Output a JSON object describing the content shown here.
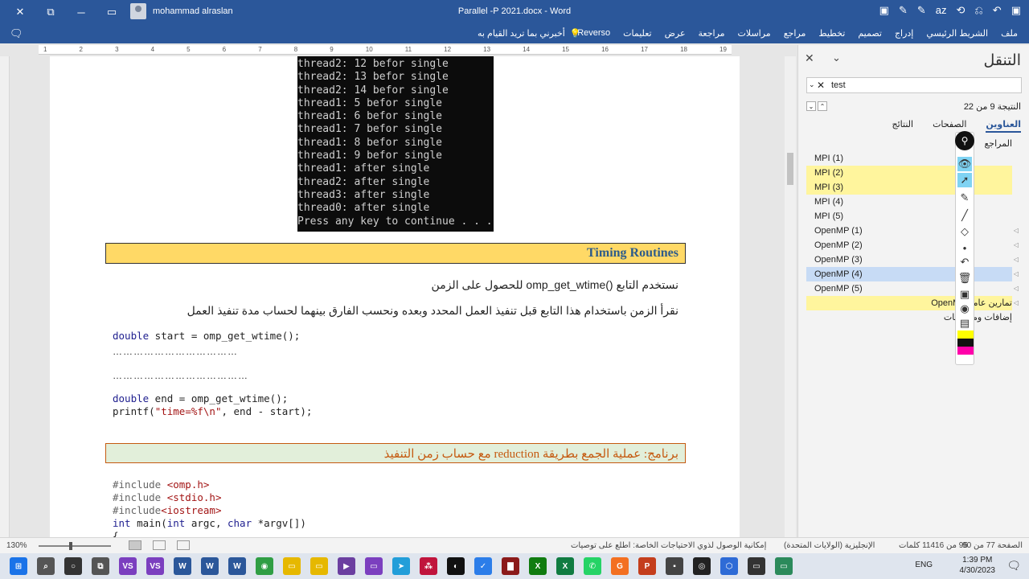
{
  "titlebar": {
    "username": "mohammad alraslan",
    "document_title": "Parallel -P 2021.docx  -  Word",
    "left_icons": [
      "✕",
      "⧉",
      "─",
      "▭"
    ],
    "right_icons": [
      "▣",
      "✎",
      "✎",
      "az",
      "⟲",
      "⎌",
      "↶",
      "▣"
    ]
  },
  "ribbon": {
    "tabs": [
      "ملف",
      "الشريط الرئيسي",
      "إدراج",
      "تصميم",
      "تخطيط",
      "مراجع",
      "مراسلات",
      "مراجعة",
      "عرض",
      "تعليمات",
      "Reverso"
    ],
    "tell_me": "أخبرني بما تريد القيام به",
    "comment_icon": "comment-icon",
    "lightbulb_icon": "lightbulb-icon"
  },
  "ruler": {
    "marks": [
      "19",
      "18",
      "17",
      "16",
      "15",
      "14",
      "13",
      "12",
      "11",
      "10",
      "9",
      "8",
      "7",
      "6",
      "5",
      "4",
      "3",
      "2",
      "1"
    ]
  },
  "document": {
    "console_lines": [
      "thread2: 12 befor single",
      "thread2: 13 befor single",
      "thread2: 14 befor single",
      "thread1: 5 befor single",
      "thread1: 6 befor single",
      "thread1: 7 befor single",
      "thread1: 8 befor single",
      "thread1: 9 befor single",
      "thread1: after single",
      "thread2: after single",
      "thread3: after single",
      "thread0: after single",
      "Press any key to continue . . ."
    ],
    "heading": "Timing Routines",
    "arabic_line1": "نستخدم التابع ()omp_get_wtime للحصول على الزمن",
    "arabic_line2": "نقرأ الزمن باستخدام هذا التابع قبل تنفيذ العمل المحدد وبعده ونحسب الفارق بينهما لحساب مدة تنفيذ العمل",
    "code1_kw": "double",
    "code1_rest": " start = omp_get_wtime();",
    "dots1": "………………………………",
    "dots2": "…………………………………",
    "code2_kw": "double",
    "code2_rest": " end = omp_get_wtime();",
    "code3_fn": "printf(",
    "code3_str": "\"time=%f\\n\"",
    "code3_rest": ", end - start);",
    "program_heading": "برنامج: عملية الجمع بطريقة reduction مع حساب زمن التنفيذ",
    "inc1_dir": "#include ",
    "inc1_file": "<omp.h>",
    "inc2_dir": "#include ",
    "inc2_file": "<stdio.h>",
    "inc3_dir": "#include",
    "inc3_file": "<iostream>",
    "main_line_kw": "int",
    "main_line_rest": " main(",
    "main_line_kw2": "int",
    "main_line_rest2": " argc, ",
    "main_line_kw3": "char",
    "main_line_rest3": " *argv[])",
    "brace": "{"
  },
  "nav": {
    "title": "التنقل",
    "search_value": "test",
    "result_text": "النتيجة 9 من 22",
    "tabs": [
      "العناوين",
      "الصفحات",
      "النتائج"
    ],
    "items": [
      {
        "label": "المراجع",
        "style": "ar"
      },
      {
        "label": "MPI (1)",
        "style": ""
      },
      {
        "label": "MPI (2)",
        "style": "hl"
      },
      {
        "label": "MPI (3)",
        "style": "hl"
      },
      {
        "label": "MPI (4)",
        "style": ""
      },
      {
        "label": "MPI (5)",
        "style": ""
      },
      {
        "label": "OpenMP (1)",
        "style": ""
      },
      {
        "label": "OpenMP (2)",
        "style": ""
      },
      {
        "label": "OpenMP (3)",
        "style": ""
      },
      {
        "label": "OpenMP (4)",
        "style": "sel"
      },
      {
        "label": "OpenMP (5)",
        "style": ""
      },
      {
        "label": "تمارين عامة OpenMP",
        "style": "hl ar"
      },
      {
        "label": "إضافات وملاحظات",
        "style": "ar"
      }
    ]
  },
  "pentool": {
    "colors": [
      "#ffff00",
      "#111111",
      "#ff00aa"
    ]
  },
  "statusbar": {
    "zoom": "130%",
    "page_info": "الصفحة 77 من 90",
    "words": "95 من 11416 كلمات",
    "language": "الإنجليزية (الولايات المتحدة)",
    "accessibility": "إمكانية الوصول لذوي الاحتياجات الخاصة: اطلع على توصيات"
  },
  "taskbar": {
    "time": "1:39 PM",
    "date": "4/30/2023",
    "lang": "ENG",
    "apps": [
      {
        "label": "⊞",
        "color": "#1a73e8"
      },
      {
        "label": "⌕",
        "color": "#555"
      },
      {
        "label": "○",
        "color": "#333"
      },
      {
        "label": "⧉",
        "color": "#555"
      },
      {
        "label": "VS",
        "color": "#7b3fbf"
      },
      {
        "label": "VS",
        "color": "#7b3fbf"
      },
      {
        "label": "W",
        "color": "#2b579a"
      },
      {
        "label": "W",
        "color": "#2b579a"
      },
      {
        "label": "W",
        "color": "#2b579a"
      },
      {
        "label": "◉",
        "color": "#2f9e44"
      },
      {
        "label": "▭",
        "color": "#e6b800"
      },
      {
        "label": "▭",
        "color": "#e6b800"
      },
      {
        "label": "▶",
        "color": "#6b3fa0"
      },
      {
        "label": "▭",
        "color": "#7b3fbf"
      },
      {
        "label": "➤",
        "color": "#229ed9"
      },
      {
        "label": "⁂",
        "color": "#c0143c"
      },
      {
        "label": "◐",
        "color": "#111"
      },
      {
        "label": "✓",
        "color": "#2b7de9"
      },
      {
        "label": "▇",
        "color": "#8b1a1a"
      },
      {
        "label": "X",
        "color": "#107c10"
      },
      {
        "label": "X",
        "color": "#107c41"
      },
      {
        "label": "✆",
        "color": "#25d366"
      },
      {
        "label": "G",
        "color": "#f37021"
      },
      {
        "label": "P",
        "color": "#c43e1c"
      },
      {
        "label": "▪",
        "color": "#444"
      },
      {
        "label": "◎",
        "color": "#222"
      },
      {
        "label": "⬡",
        "color": "#2e6bd6"
      },
      {
        "label": "▭",
        "color": "#333"
      },
      {
        "label": "▭",
        "color": "#2b8a5b"
      }
    ]
  }
}
